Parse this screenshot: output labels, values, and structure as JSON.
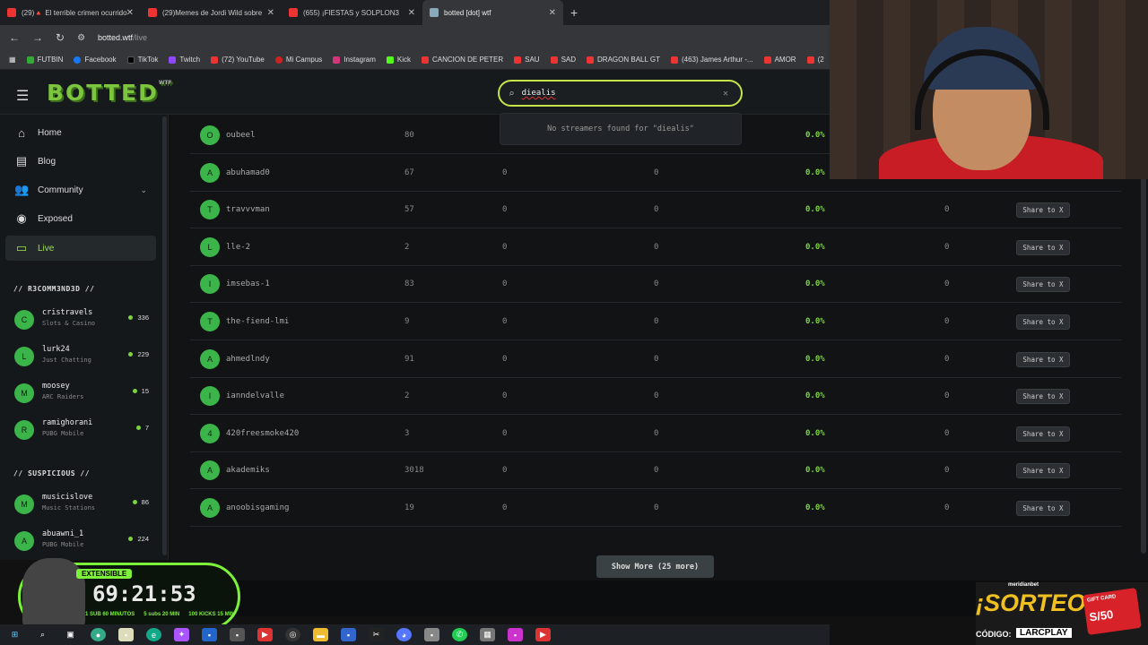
{
  "browser": {
    "tabs": [
      {
        "title": "(29)🔺 El terrible crimen ocurrido",
        "icon": "youtube-icon",
        "active": false
      },
      {
        "title": "(29)Memes de Jordi Wild sobre",
        "icon": "youtube-icon",
        "active": false
      },
      {
        "title": "(655) ¡FIESTAS y SOLPLON3",
        "icon": "youtube-icon",
        "active": false
      },
      {
        "title": "botted [dot] wtf",
        "icon": "botted-icon",
        "active": true
      }
    ],
    "url_host": "botted.wtf",
    "url_path": "/live",
    "bookmarks": [
      "FUTBIN",
      "Facebook",
      "TikTok",
      "Twitch",
      "(72) YouTube",
      "Mi Campus",
      "Instagram",
      "Kick",
      "CANCION DE PETER",
      "SAU",
      "SAD",
      "DRAGON BALL GT",
      "(463) James Arthur -...",
      "AMOR",
      "(2"
    ]
  },
  "header": {
    "logo": "BOTTED",
    "logo_sup": "WTF",
    "search_value": "diealis",
    "search_empty": "No streamers found for \"diealis\""
  },
  "sidebar": {
    "nav": [
      {
        "label": "Home",
        "icon": "home-icon"
      },
      {
        "label": "Blog",
        "icon": "document-icon"
      },
      {
        "label": "Community",
        "icon": "users-icon"
      },
      {
        "label": "Exposed",
        "icon": "eye-icon"
      },
      {
        "label": "Live",
        "icon": "tv-icon"
      }
    ],
    "recommended_title": "// R3COMM3ND3D //",
    "recommended": [
      {
        "initial": "C",
        "name": "cristravels",
        "game": "Slots & Casino",
        "viewers": "336"
      },
      {
        "initial": "L",
        "name": "lurk24",
        "game": "Just Chatting",
        "viewers": "229"
      },
      {
        "initial": "M",
        "name": "moosey",
        "game": "ARC Raiders",
        "viewers": "15"
      },
      {
        "initial": "R",
        "name": "ramighorani",
        "game": "PUBG Mobile",
        "viewers": "7"
      }
    ],
    "suspicious_title": "// SUSPICIOUS //",
    "suspicious": [
      {
        "initial": "M",
        "name": "musicislove",
        "game": "Music Stations",
        "viewers": "86"
      },
      {
        "initial": "A",
        "name": "abuawni_1",
        "game": "PUBG Mobile",
        "viewers": "224"
      }
    ]
  },
  "table": {
    "share_label": "Share to X",
    "rows": [
      {
        "initial": "O",
        "name": "oubeel",
        "c1": "80",
        "c2": "",
        "c3": "",
        "c4": "0.0%",
        "c5": "",
        "share": false
      },
      {
        "initial": "A",
        "name": "abuhamad0",
        "c1": "67",
        "c2": "0",
        "c3": "0",
        "c4": "0.0%",
        "c5": "",
        "share": false
      },
      {
        "initial": "T",
        "name": "travvvman",
        "c1": "57",
        "c2": "0",
        "c3": "0",
        "c4": "0.0%",
        "c5": "0",
        "share": true
      },
      {
        "initial": "L",
        "name": "lle-2",
        "c1": "2",
        "c2": "0",
        "c3": "0",
        "c4": "0.0%",
        "c5": "0",
        "share": true
      },
      {
        "initial": "I",
        "name": "imsebas-1",
        "c1": "83",
        "c2": "0",
        "c3": "0",
        "c4": "0.0%",
        "c5": "0",
        "share": true
      },
      {
        "initial": "T",
        "name": "the-fiend-lmi",
        "c1": "9",
        "c2": "0",
        "c3": "0",
        "c4": "0.0%",
        "c5": "0",
        "share": true
      },
      {
        "initial": "A",
        "name": "ahmedlndy",
        "c1": "91",
        "c2": "0",
        "c3": "0",
        "c4": "0.0%",
        "c5": "0",
        "share": true
      },
      {
        "initial": "I",
        "name": "ianndelvalle",
        "c1": "2",
        "c2": "0",
        "c3": "0",
        "c4": "0.0%",
        "c5": "0",
        "share": true
      },
      {
        "initial": "4",
        "name": "420freesmoke420",
        "c1": "3",
        "c2": "0",
        "c3": "0",
        "c4": "0.0%",
        "c5": "0",
        "share": true
      },
      {
        "initial": "A",
        "name": "akademiks",
        "c1": "3018",
        "c2": "0",
        "c3": "0",
        "c4": "0.0%",
        "c5": "0",
        "share": true
      },
      {
        "initial": "A",
        "name": "anoobisgaming",
        "c1": "19",
        "c2": "0",
        "c3": "0",
        "c4": "0.0%",
        "c5": "0",
        "share": true
      }
    ],
    "show_more": "Show More (25 more)"
  },
  "overlay": {
    "timer_label": "EXTENSIBLE",
    "timer_value": "69:21:53",
    "timer_sub": [
      "1 SUB 60 MINUTOS",
      "5 subs 20 MIN",
      "100 KICKS 15 MIN"
    ],
    "ad_brand": "meridianbet",
    "ad_title": "¡SORTEO!",
    "ad_code_label": "CÓDIGO:",
    "ad_code": "LARCPLAY",
    "ad_card_label": "GIFT CARD",
    "ad_card_value": "S/50"
  },
  "colors": {
    "accent": "#7cd33f",
    "search_border": "#c7e34a",
    "logo": "#7cc53f"
  }
}
